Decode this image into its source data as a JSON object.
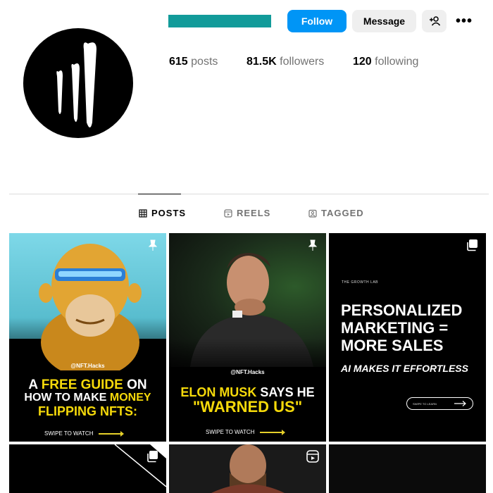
{
  "profile": {
    "follow_label": "Follow",
    "message_label": "Message",
    "more_label": "•••",
    "stats": {
      "posts_count": "615",
      "posts_label": "posts",
      "followers_count": "81.5K",
      "followers_label": "followers",
      "following_count": "120",
      "following_label": "following"
    }
  },
  "tabs": [
    {
      "label": "POSTS",
      "icon": "grid-icon",
      "active": true
    },
    {
      "label": "REELS",
      "icon": "reels-icon",
      "active": false
    },
    {
      "label": "TAGGED",
      "icon": "tagged-icon",
      "active": false
    }
  ],
  "posts": [
    {
      "handle": "@NFT.Hacks",
      "line1_white": "A ",
      "line1_yellow": "FREE GUIDE",
      "line1_white2": " ON",
      "line2_white": "HOW TO MAKE ",
      "line2_yellow": "MONEY",
      "line3_yellow": "FLIPPING NFTS:",
      "swipe": "SWIPE TO WATCH",
      "icon": "pin-icon"
    },
    {
      "handle": "@NFT.Hacks",
      "line1_yellow": "ELON MUSK",
      "line1_white": " SAYS HE",
      "line2_yellow": "\"WARNED US\"",
      "swipe": "SWIPE TO WATCH",
      "icon": "pin-icon"
    },
    {
      "small": "THE GROWTH LAB",
      "line1": "PERSONALIZED",
      "line2": "MARKETING =",
      "line3": "MORE SALES",
      "subline": "AI MAKES IT EFFORTLESS",
      "pill_text": "SWIPE TO LEARN",
      "icon": "carousel-icon"
    }
  ],
  "colors": {
    "brand_teal": "#129b9a",
    "follow_blue": "#0095f6",
    "post_yellow": "#f5d90a"
  }
}
